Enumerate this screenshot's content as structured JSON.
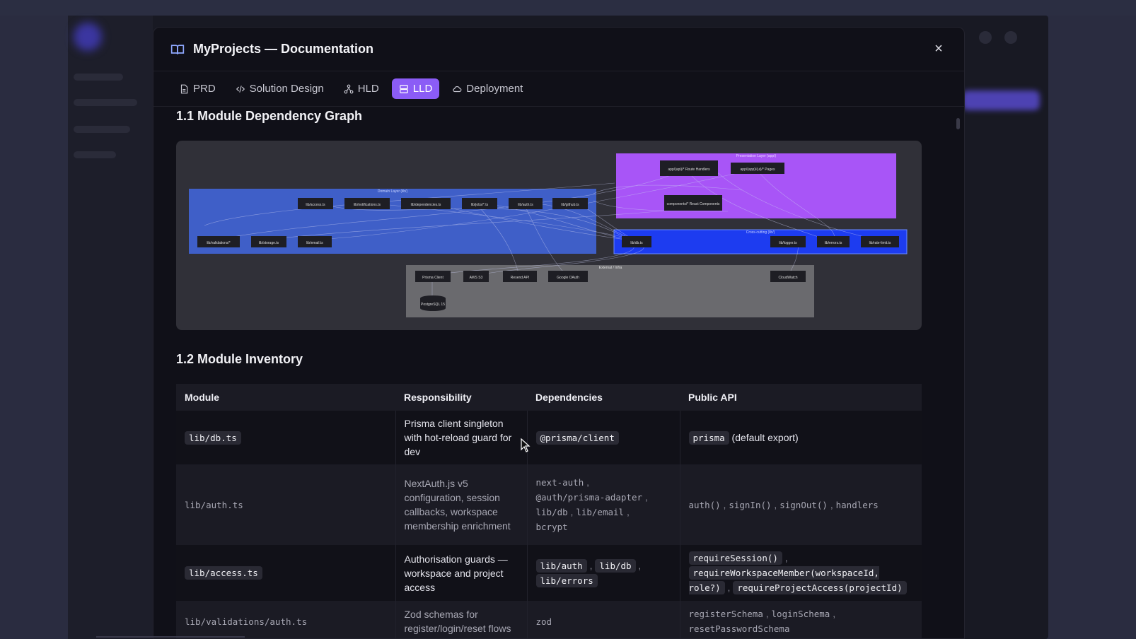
{
  "modal": {
    "title": "MyProjects — Documentation",
    "close_label": "×"
  },
  "tabs": [
    {
      "label": "PRD",
      "icon": "file-icon",
      "active": false
    },
    {
      "label": "Solution Design",
      "icon": "code-icon",
      "active": false
    },
    {
      "label": "HLD",
      "icon": "hierarchy-icon",
      "active": false
    },
    {
      "label": "LLD",
      "icon": "database-icon",
      "active": true
    },
    {
      "label": "Deployment",
      "icon": "cloud-icon",
      "active": false
    }
  ],
  "sections": {
    "graph_heading": "1.1 Module Dependency Graph",
    "inventory_heading": "1.2 Module Inventory"
  },
  "graph": {
    "groups": [
      {
        "label": "Domain Layer (lib/)",
        "color": "#3f5fc8"
      },
      {
        "label": "Presentation Layer (app/)",
        "color": "#a855f7"
      },
      {
        "label": "Cross-cutting (lib/)",
        "color": "#1d3cf0"
      },
      {
        "label": "External / Infra",
        "color": "#6a6a6e"
      }
    ],
    "domain_nodes": [
      "lib/access.ts",
      "lib/notifications.ts",
      "lib/dependencies.ts",
      "lib/jobs/*.ts",
      "lib/auth.ts",
      "lib/github.ts",
      "lib/validations/*",
      "lib/storage.ts",
      "lib/email.ts"
    ],
    "presentation_nodes": [
      "app/(api)/* Route Handlers",
      "app/(app)/(ui)/* Pages",
      "components/* React Components"
    ],
    "crosscutting_nodes": [
      "lib/db.ts",
      "lib/logger.ts",
      "lib/errors.ts",
      "lib/rate-limit.ts"
    ],
    "external_nodes": [
      "Prisma Client",
      "AWS S3",
      "Resend API",
      "Google OAuth",
      "CloudWatch",
      "PostgreSQL 15"
    ]
  },
  "table": {
    "headers": [
      "Module",
      "Responsibility",
      "Dependencies",
      "Public API"
    ],
    "rows": [
      {
        "module": "lib/db.ts",
        "responsibility": "Prisma client singleton with hot-reload guard for dev",
        "dependencies": [
          "@prisma/client"
        ],
        "public_api": [
          "prisma"
        ],
        "public_api_note": "(default export)"
      },
      {
        "module": "lib/auth.ts",
        "responsibility": "NextAuth.js v5 configuration, session callbacks, workspace membership enrichment",
        "dependencies": [
          "next-auth",
          "@auth/prisma-adapter",
          "lib/db",
          "lib/email",
          "bcrypt"
        ],
        "public_api": [
          "auth()",
          "signIn()",
          "signOut()",
          "handlers"
        ]
      },
      {
        "module": "lib/access.ts",
        "responsibility": "Authorisation guards — workspace and project access",
        "dependencies": [
          "lib/auth",
          "lib/db",
          "lib/errors"
        ],
        "public_api": [
          "requireSession()",
          "requireWorkspaceMember(workspaceId, role?)",
          "requireProjectAccess(projectId)"
        ]
      },
      {
        "module": "lib/validations/auth.ts",
        "responsibility": "Zod schemas for register/login/reset flows",
        "dependencies": [
          "zod"
        ],
        "public_api": [
          "registerSchema",
          "loginSchema",
          "resetPasswordSchema"
        ]
      }
    ]
  }
}
